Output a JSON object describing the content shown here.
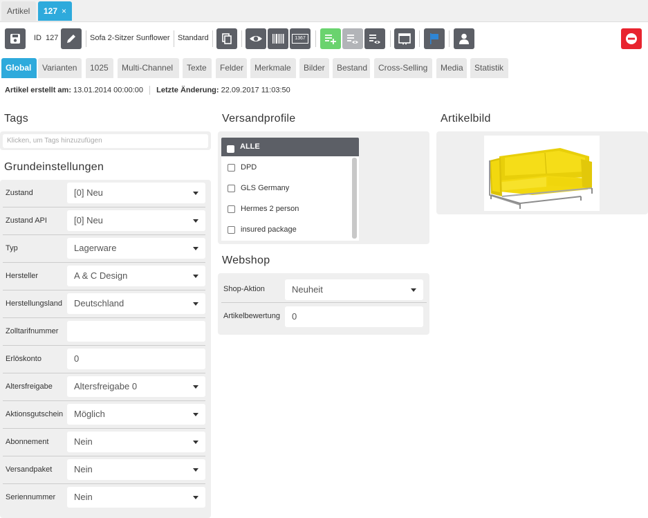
{
  "top_tabs": {
    "artikel": "Artikel",
    "current": "127",
    "close": "×"
  },
  "toolbar": {
    "id_label": "ID",
    "id_value": "127",
    "article_name": "Sofa 2-Sitzer Sunflower",
    "variant": "Standard",
    "barcode_number": "1367"
  },
  "subtabs": [
    "Global",
    "Varianten",
    "1025",
    "Multi-Channel",
    "Texte",
    "Felder",
    "Merkmale",
    "Bilder",
    "Bestand",
    "Cross-Selling",
    "Media",
    "Statistik"
  ],
  "meta": {
    "created_label": "Artikel erstellt am:",
    "created_value": "13.01.2014 00:00:00",
    "changed_label": "Letzte Änderung:",
    "changed_value": "22.09.2017 11:03:50"
  },
  "tags": {
    "title": "Tags",
    "placeholder": "Klicken, um Tags hinzuzufügen"
  },
  "grundeinstellungen": {
    "title": "Grundeinstellungen",
    "fields": [
      {
        "label": "Zustand",
        "value": "[0] Neu",
        "dropdown": true
      },
      {
        "label": "Zustand API",
        "value": "[0] Neu",
        "dropdown": true
      },
      {
        "label": "Typ",
        "value": "Lagerware",
        "dropdown": true
      },
      {
        "label": "Hersteller",
        "value": "A & C Design",
        "dropdown": true
      },
      {
        "label": "Herstellungsland",
        "value": "Deutschland",
        "dropdown": true
      },
      {
        "label": "Zolltarifnummer",
        "value": "",
        "dropdown": false
      },
      {
        "label": "Erlöskonto",
        "value": "0",
        "dropdown": false
      },
      {
        "label": "Altersfreigabe",
        "value": "Altersfreigabe 0",
        "dropdown": true
      },
      {
        "label": "Aktionsgutschein",
        "value": "Möglich",
        "dropdown": true
      },
      {
        "label": "Abonnement",
        "value": "Nein",
        "dropdown": true
      },
      {
        "label": "Versandpaket",
        "value": "Nein",
        "dropdown": true
      },
      {
        "label": "Seriennummer",
        "value": "Nein",
        "dropdown": true
      }
    ]
  },
  "versandprofile": {
    "title": "Versandprofile",
    "all_label": "ALLE",
    "items": [
      "DPD",
      "GLS Germany",
      "Hermes 2 person",
      "insured package"
    ]
  },
  "webshop": {
    "title": "Webshop",
    "shop_aktion_label": "Shop-Aktion",
    "shop_aktion_value": "Neuheit",
    "bewertung_label": "Artikelbewertung",
    "bewertung_value": "0"
  },
  "artikelbild": {
    "title": "Artikelbild"
  },
  "colors": {
    "accent": "#2eaadc",
    "toolbar_dark": "#5c5f66",
    "toolbar_green": "#6ad36e",
    "danger": "#e8242f",
    "panel_bg": "#efefef",
    "sofa": "#f2d80f"
  }
}
